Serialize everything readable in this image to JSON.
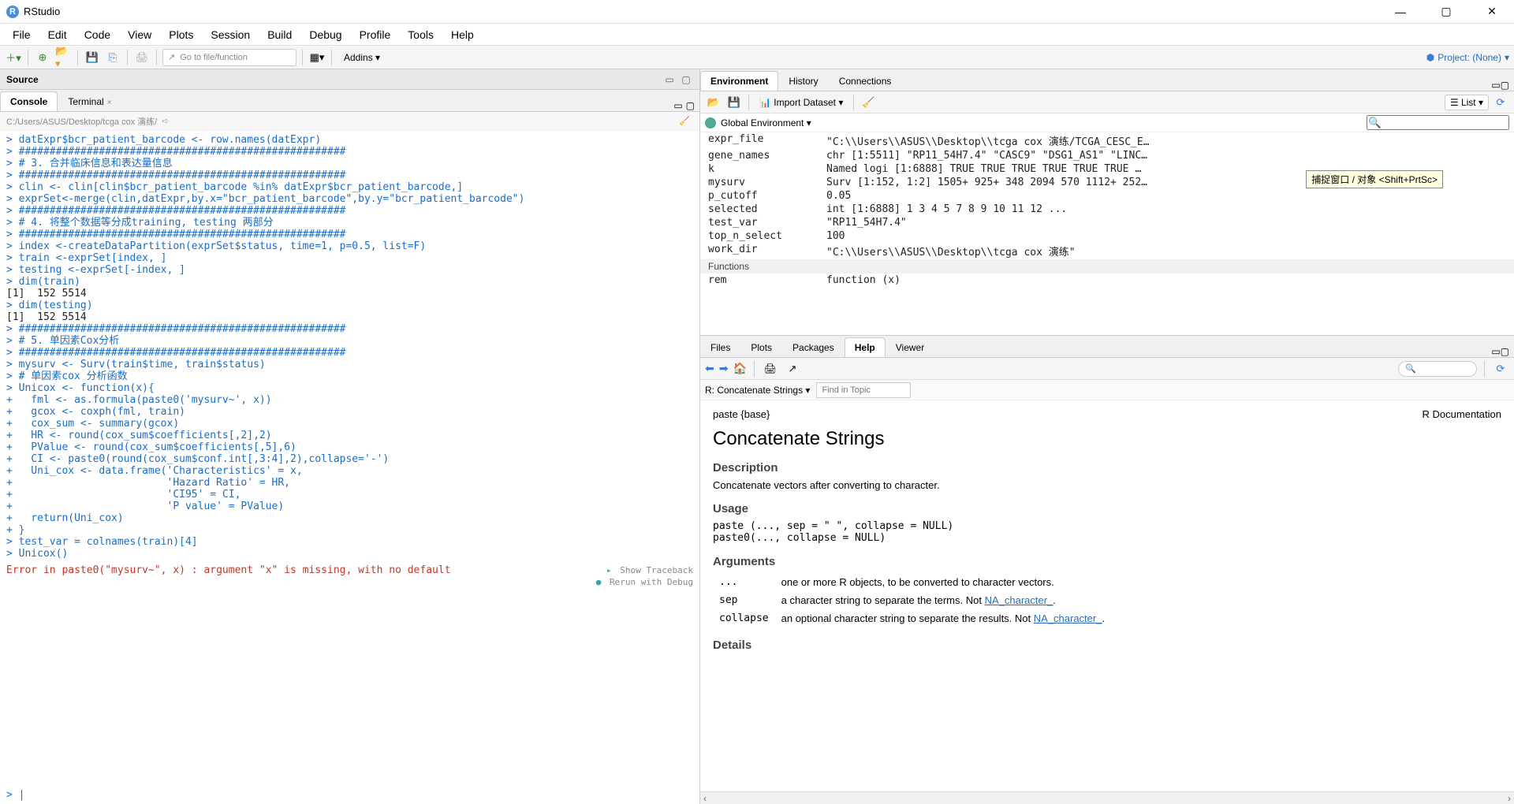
{
  "title": "RStudio",
  "menu": [
    "File",
    "Edit",
    "Code",
    "View",
    "Plots",
    "Session",
    "Build",
    "Debug",
    "Profile",
    "Tools",
    "Help"
  ],
  "toolbar": {
    "gotofile_placeholder": "Go to file/function",
    "addins": "Addins",
    "project": "Project: (None)"
  },
  "source_title": "Source",
  "tabs_left": {
    "console": "Console",
    "terminal": "Terminal"
  },
  "path": "C:/Users/ASUS/Desktop/tcga cox 演练/",
  "console_lines": [
    {
      "c": "blue",
      "t": "> datExpr$bcr_patient_barcode <- row.names(datExpr)"
    },
    {
      "c": "blue",
      "t": "> #####################################################"
    },
    {
      "c": "blue",
      "t": "> # 3. 合并临床信息和表达量信息"
    },
    {
      "c": "blue",
      "t": "> #####################################################"
    },
    {
      "c": "blue",
      "t": "> clin <- clin[clin$bcr_patient_barcode %in% datExpr$bcr_patient_barcode,]"
    },
    {
      "c": "blue",
      "t": "> exprSet<-merge(clin,datExpr,by.x=\"bcr_patient_barcode\",by.y=\"bcr_patient_barcode\")"
    },
    {
      "c": "blue",
      "t": "> #####################################################"
    },
    {
      "c": "blue",
      "t": "> # 4. 将整个数据等分成training, testing 两部分"
    },
    {
      "c": "blue",
      "t": "> #####################################################"
    },
    {
      "c": "blue",
      "t": "> index <-createDataPartition(exprSet$status, time=1, p=0.5, list=F)"
    },
    {
      "c": "blue",
      "t": "> train <-exprSet[index, ]"
    },
    {
      "c": "blue",
      "t": "> testing <-exprSet[-index, ]"
    },
    {
      "c": "blue",
      "t": "> dim(train)"
    },
    {
      "c": "black",
      "t": "[1]  152 5514"
    },
    {
      "c": "blue",
      "t": "> dim(testing)"
    },
    {
      "c": "black",
      "t": "[1]  152 5514"
    },
    {
      "c": "blue",
      "t": "> #####################################################"
    },
    {
      "c": "blue",
      "t": "> # 5. 单因素Cox分析"
    },
    {
      "c": "blue",
      "t": "> #####################################################"
    },
    {
      "c": "blue",
      "t": "> mysurv <- Surv(train$time, train$status)"
    },
    {
      "c": "blue",
      "t": "> # 单因素cox 分析函数"
    },
    {
      "c": "blue",
      "t": "> Unicox <- function(x){"
    },
    {
      "c": "blue",
      "t": "+   fml <- as.formula(paste0('mysurv~', x))"
    },
    {
      "c": "blue",
      "t": "+   gcox <- coxph(fml, train)"
    },
    {
      "c": "blue",
      "t": "+   cox_sum <- summary(gcox)"
    },
    {
      "c": "blue",
      "t": "+   HR <- round(cox_sum$coefficients[,2],2)"
    },
    {
      "c": "blue",
      "t": "+   PValue <- round(cox_sum$coefficients[,5],6)"
    },
    {
      "c": "blue",
      "t": "+   CI <- paste0(round(cox_sum$conf.int[,3:4],2),collapse='-')"
    },
    {
      "c": "blue",
      "t": "+   Uni_cox <- data.frame('Characteristics' = x,"
    },
    {
      "c": "blue",
      "t": "+                         'Hazard Ratio' = HR,"
    },
    {
      "c": "blue",
      "t": "+                         'CI95' = CI,"
    },
    {
      "c": "blue",
      "t": "+                         'P value' = PValue)"
    },
    {
      "c": "blue",
      "t": "+   return(Uni_cox)"
    },
    {
      "c": "blue",
      "t": "+ }"
    },
    {
      "c": "blue",
      "t": "> test_var = colnames(train)[4]"
    },
    {
      "c": "blue",
      "t": "> Unicox()"
    }
  ],
  "error": "Error in paste0(\"mysurv~\", x) : argument \"x\" is missing, with no default",
  "trace": {
    "show": "Show Traceback",
    "debug": "Rerun with Debug"
  },
  "prompt": "> |",
  "env_tabs": [
    "Environment",
    "History",
    "Connections"
  ],
  "env_tool": {
    "import": "Import Dataset",
    "list": "List"
  },
  "globenv": "Global Environment",
  "env_items": [
    {
      "k": "expr_file",
      "v": "\"C:\\\\Users\\\\ASUS\\\\Desktop\\\\tcga cox 演练/TCGA_CESC_E…"
    },
    {
      "k": "gene_names",
      "v": "chr [1:5511] \"RP11_54H7.4\" \"CASC9\" \"DSG1_AS1\" \"LINC…"
    },
    {
      "k": "k",
      "v": "Named logi [1:6888] TRUE TRUE TRUE TRUE TRUE TRUE …"
    },
    {
      "k": "mysurv",
      "v": "Surv [1:152, 1:2] 1505+ 925+ 348 2094 570 1112+ 252…"
    },
    {
      "k": "p_cutoff",
      "v": "0.05"
    },
    {
      "k": "selected",
      "v": "int [1:6888] 1 3 4 5 7 8 9 10 11 12 ..."
    },
    {
      "k": "test_var",
      "v": "\"RP11_54H7.4\""
    },
    {
      "k": "top_n_select",
      "v": "100"
    },
    {
      "k": "work_dir",
      "v": "\"C:\\\\Users\\\\ASUS\\\\Desktop\\\\tcga cox 演练\""
    }
  ],
  "env_func_label": "Functions",
  "env_funcs": [
    {
      "k": "rem",
      "v": "function (x)"
    }
  ],
  "tooltip": "捕捉窗口 / 对象 <Shift+PrtSc>",
  "help_tabs": [
    "Files",
    "Plots",
    "Packages",
    "Help",
    "Viewer"
  ],
  "help_topic": "R: Concatenate Strings",
  "help_find_placeholder": "Find in Topic",
  "help": {
    "pkg": "paste {base}",
    "doc": "R Documentation",
    "title": "Concatenate Strings",
    "desc_h": "Description",
    "desc": "Concatenate vectors after converting to character.",
    "usage_h": "Usage",
    "usage": "paste (..., sep = \" \", collapse = NULL)\npaste0(..., collapse = NULL)",
    "args_h": "Arguments",
    "args": [
      {
        "a": "...",
        "d": "one or more R objects, to be converted to character vectors."
      },
      {
        "a": "sep",
        "d": "a character string to separate the terms. Not ",
        "link": "NA_character_"
      },
      {
        "a": "collapse",
        "d": "an optional character string to separate the results. Not ",
        "link": "NA_character_"
      }
    ],
    "details_h": "Details"
  }
}
